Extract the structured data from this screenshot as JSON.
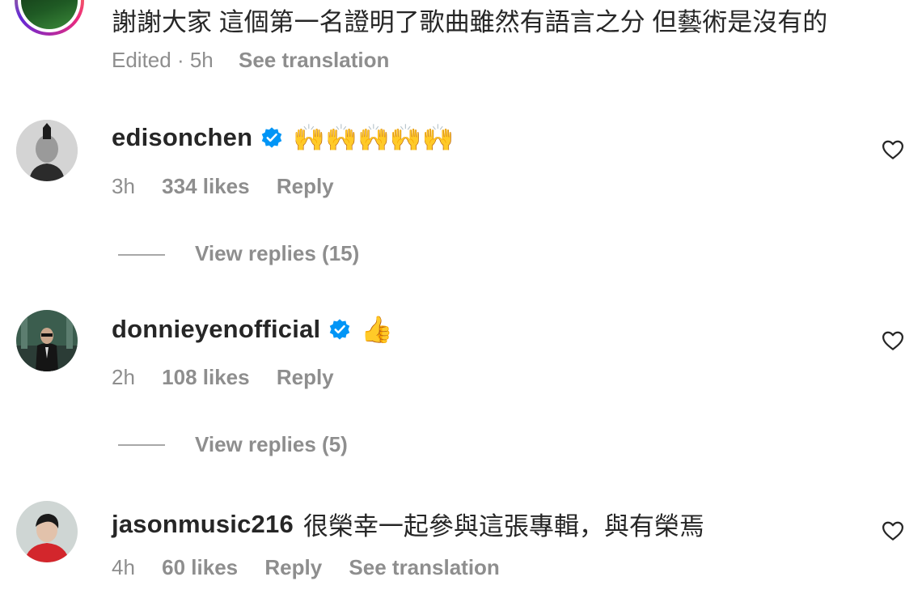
{
  "top_comment": {
    "text": "謝謝大家 這個第一名證明了歌曲雖然有語言之分 但藝術是沒有的",
    "meta_edited": "Edited · 5h",
    "see_translation": "See translation"
  },
  "comments": [
    {
      "username": "edisonchen",
      "verified": true,
      "text": "🙌🙌🙌🙌🙌",
      "time": "3h",
      "likes": "334 likes",
      "reply": "Reply",
      "view_replies": "View replies (15)"
    },
    {
      "username": "donnieyenofficial",
      "verified": true,
      "text": "👍",
      "time": "2h",
      "likes": "108 likes",
      "reply": "Reply",
      "view_replies": "View replies (5)"
    },
    {
      "username": "jasonmusic216",
      "verified": false,
      "text": "很榮幸一起參與這張專輯，與有榮焉",
      "time": "4h",
      "likes": "60 likes",
      "reply": "Reply",
      "see_translation": "See translation"
    }
  ],
  "colors": {
    "text": "#262626",
    "meta": "#8e8e8e",
    "verified": "#0095f6",
    "story_ring_start": "#f9ce34",
    "story_ring_end": "#ee2a7b"
  },
  "icons": {
    "heart": "heart-outline-icon",
    "verified": "verified-badge-icon"
  }
}
